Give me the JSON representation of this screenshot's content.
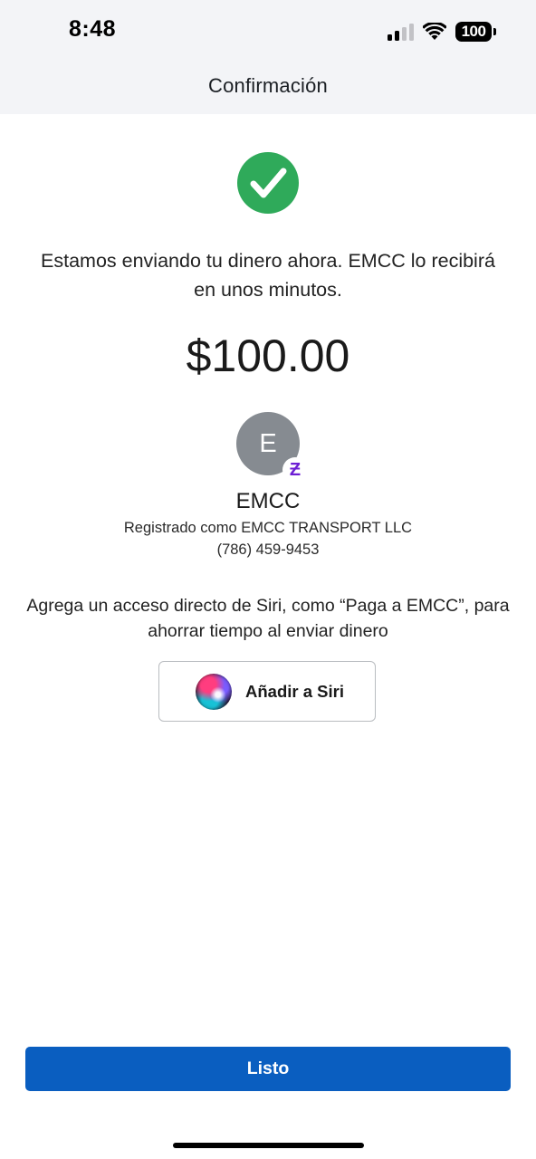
{
  "status_bar": {
    "time": "8:48",
    "battery": "100"
  },
  "header": {
    "title": "Confirmación"
  },
  "confirmation": {
    "message": "Estamos enviando tu dinero ahora. EMCC lo recibirá en unos minutos.",
    "amount": "$100.00",
    "success_color": "#2faa5a"
  },
  "recipient": {
    "avatar_initial": "E",
    "badge_glyph": "Ƶ",
    "name": "EMCC",
    "registered": "Registrado como EMCC TRANSPORT LLC",
    "phone": "(786) 459-9453"
  },
  "siri": {
    "prompt": "Agrega un acceso directo de Siri, como “Paga a EMCC”, para ahorrar tiempo al enviar dinero",
    "button_label": "Añadir a Siri",
    "icon": "siri-icon"
  },
  "actions": {
    "done_label": "Listo",
    "done_color": "#0a5ec0"
  }
}
